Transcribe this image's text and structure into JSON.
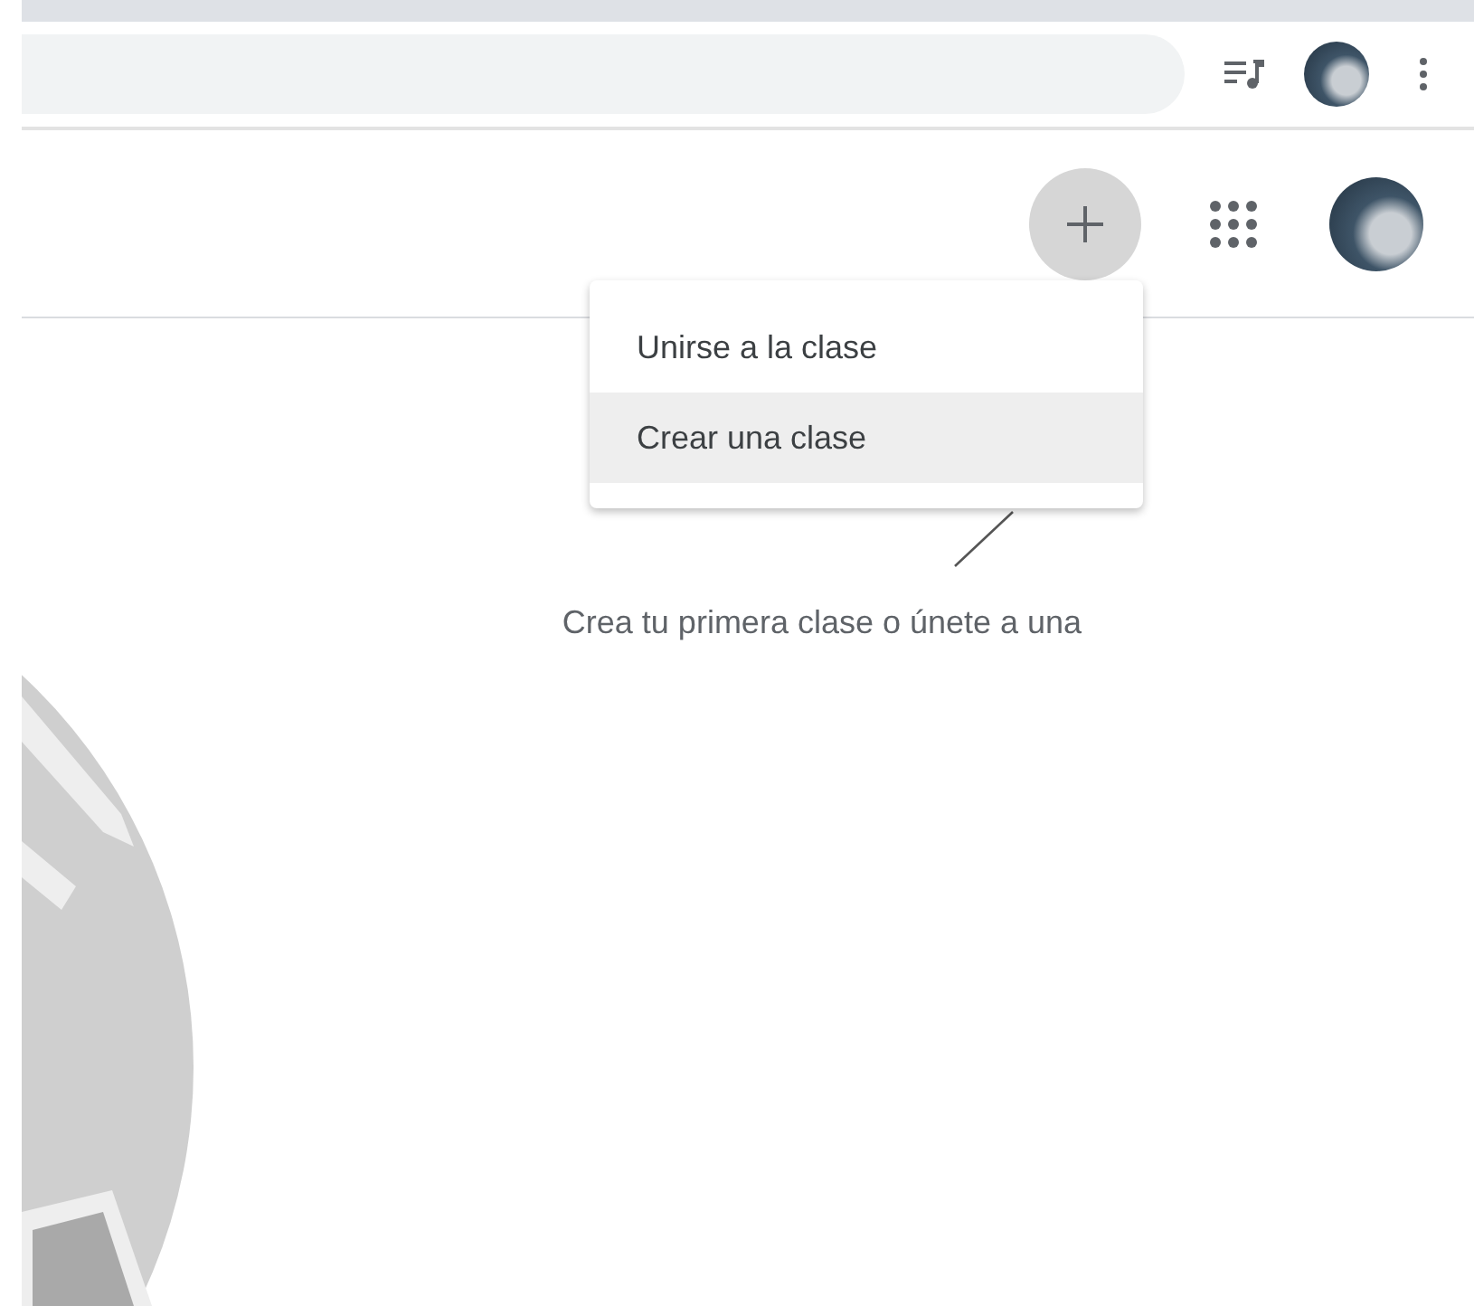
{
  "menu": {
    "items": [
      {
        "label": "Unirse a la clase",
        "selected": false
      },
      {
        "label": "Crear una clase",
        "selected": true
      }
    ]
  },
  "empty_state": {
    "message": "Crea tu primera clase o únete a una"
  }
}
